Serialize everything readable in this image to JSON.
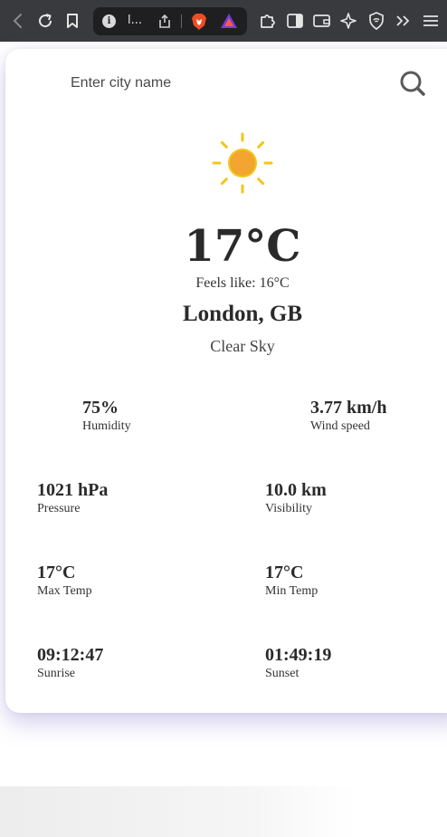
{
  "browser": {
    "url_text": "l...",
    "icons": [
      "back-icon",
      "reload-icon",
      "bookmark-icon",
      "site-info-icon",
      "share-icon",
      "brave-shields-icon",
      "rewards-triangle-icon",
      "extensions-icon",
      "sidebar-icon",
      "wallet-icon",
      "leo-ai-icon",
      "vpn-shield-icon",
      "overflow-chevrons-icon",
      "menu-icon"
    ]
  },
  "search": {
    "placeholder": "Enter city name",
    "value": ""
  },
  "weather": {
    "icon": "sun-icon",
    "temperature": "17°C",
    "feels_like": "Feels like: 16°C",
    "location": "London, GB",
    "condition": "Clear Sky"
  },
  "stats": {
    "humidity": {
      "value": "75%",
      "label": "Humidity"
    },
    "wind": {
      "value": "3.77 km/h",
      "label": "Wind speed"
    },
    "pressure": {
      "value": "1021 hPa",
      "label": "Pressure"
    },
    "visibility": {
      "value": "10.0 km",
      "label": "Visibility"
    },
    "max_temp": {
      "value": "17°C",
      "label": "Max Temp"
    },
    "min_temp": {
      "value": "17°C",
      "label": "Min Temp"
    },
    "sunrise": {
      "value": "09:12:47",
      "label": "Sunrise"
    },
    "sunset": {
      "value": "01:49:19",
      "label": "Sunset"
    }
  },
  "colors": {
    "toolbar_bg": "#393a3d",
    "urlbar_bg": "#1f1f21",
    "sun_core": "#f2a530",
    "sun_rays": "#f5c518",
    "text_dark": "#2a2a2a"
  }
}
